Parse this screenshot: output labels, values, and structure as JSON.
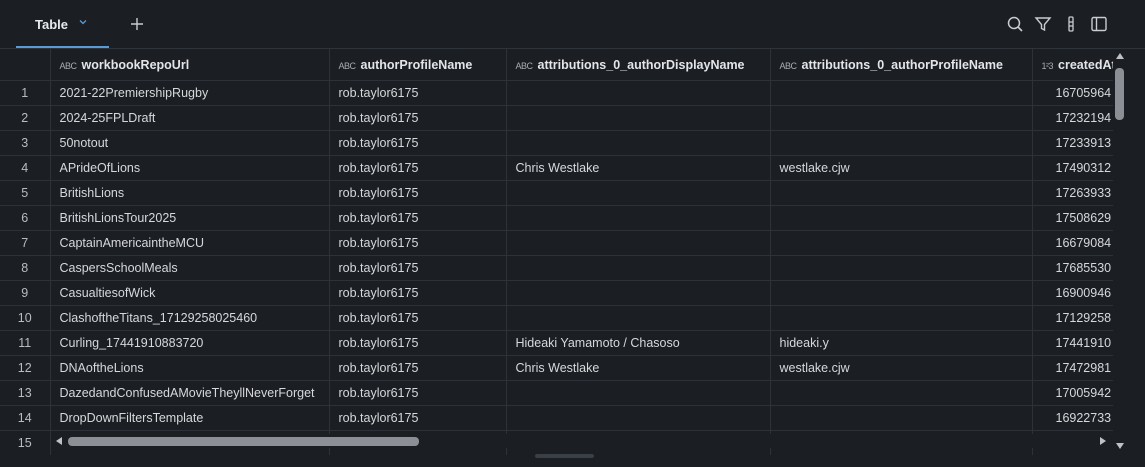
{
  "tabs": {
    "active": "Table",
    "add_symbol": "+"
  },
  "columns": [
    {
      "type_icon": "ABC",
      "label": "workbookRepoUrl"
    },
    {
      "type_icon": "ABC",
      "label": "authorProfileName"
    },
    {
      "type_icon": "ABC",
      "label": "attributions_0_authorDisplayName"
    },
    {
      "type_icon": "ABC",
      "label": "attributions_0_authorProfileName"
    },
    {
      "type_icon": "1²3",
      "label": "createdAt"
    }
  ],
  "rows": [
    [
      "1",
      "2021-22PremiershipRugby",
      "rob.taylor6175",
      "",
      "",
      "16705964"
    ],
    [
      "2",
      "2024-25FPLDraft",
      "rob.taylor6175",
      "",
      "",
      "17232194"
    ],
    [
      "3",
      "50notout",
      "rob.taylor6175",
      "",
      "",
      "17233913"
    ],
    [
      "4",
      "APrideOfLions",
      "rob.taylor6175",
      "Chris Westlake",
      "westlake.cjw",
      "17490312"
    ],
    [
      "5",
      "BritishLions",
      "rob.taylor6175",
      "",
      "",
      "17263933"
    ],
    [
      "6",
      "BritishLionsTour2025",
      "rob.taylor6175",
      "",
      "",
      "17508629"
    ],
    [
      "7",
      "CaptainAmericaintheMCU",
      "rob.taylor6175",
      "",
      "",
      "16679084"
    ],
    [
      "8",
      "CaspersSchoolMeals",
      "rob.taylor6175",
      "",
      "",
      "17685530"
    ],
    [
      "9",
      "CasualtiesofWick",
      "rob.taylor6175",
      "",
      "",
      "16900946"
    ],
    [
      "10",
      "ClashoftheTitans_17129258025460",
      "rob.taylor6175",
      "",
      "",
      "17129258"
    ],
    [
      "11",
      "Curling_17441910883720",
      "rob.taylor6175",
      "Hideaki Yamamoto / Chasoso",
      "hideaki.y",
      "17441910"
    ],
    [
      "12",
      "DNAoftheLions",
      "rob.taylor6175",
      "Chris Westlake",
      "westlake.cjw",
      "17472981"
    ],
    [
      "13",
      "DazedandConfusedAMovieTheyllNeverForget",
      "rob.taylor6175",
      "",
      "",
      "17005942"
    ],
    [
      "14",
      "DropDownFiltersTemplate",
      "rob.taylor6175",
      "",
      "",
      "16922733"
    ],
    [
      "15",
      "",
      "",
      "",
      "",
      ""
    ]
  ],
  "icons": [
    "chevron-down-icon",
    "plus-icon",
    "search-icon",
    "filter-icon",
    "column-options-icon",
    "sidebar-panel-icon"
  ]
}
